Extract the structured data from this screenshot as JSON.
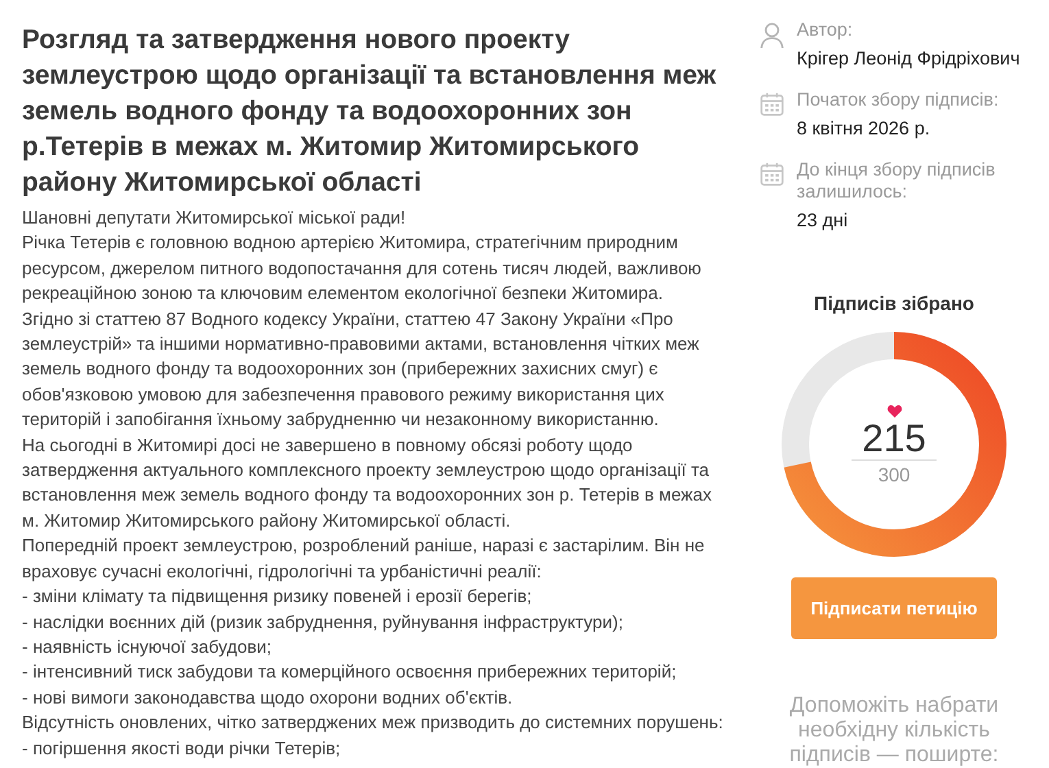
{
  "petition": {
    "title": "Розгляд та затвердження нового проекту землеустрою щодо організації та встановлення меж земель водного фонду та водоохоронних зон р.Тетерів в межах м. Житомир Житомирського району Житомирської області",
    "body": [
      "Шановні депутати Житомирської міської ради!",
      "Річка Тетерів є головною водною артерією Житомира, стратегічним природним ресурсом, джерелом питного водопостачання для сотень тисяч людей, важливою рекреаційною зоною та ключовим елементом екологічної безпеки Житомира.",
      "Згідно зі статтею 87 Водного кодексу України, статтею 47 Закону України «Про землеустрій» та іншими нормативно-правовими актами, встановлення чітких меж земель водного фонду та водоохоронних зон (прибережних захисних смуг) є обов'язковою умовою для забезпечення правового режиму використання цих територій і запобігання їхньому забрудненню чи незаконному використанню.",
      "На сьогодні в Житомирі досі не завершено в повному обсязі роботу щодо затвердження актуального комплексного проекту землеустрою щодо організації та встановлення меж земель водного фонду та водоохоронних зон р. Тетерів в межах м. Житомир Житомирського району Житомирської області.",
      "Попередній проект землеустрою, розроблений раніше, наразі є застарілим. Він не враховує сучасні екологічні, гідрологічні та урбаністичні реалії:",
      "- зміни клімату та підвищення ризику повеней і ерозії берегів;",
      "- наслідки воєнних дій (ризик забруднення, руйнування інфраструктури);",
      "- наявність існуючої забудови;",
      "- інтенсивний тиск забудови та комерційного освоєння прибережних територій;",
      "- нові вимоги законодавства щодо охорони водних об'єктів.",
      "Відсутність оновлених, чітко затверджених меж призводить до системних порушень:",
      "- погіршення якості води річки Тетерів;"
    ]
  },
  "details": [
    {
      "kind": "person",
      "label": "Автор:",
      "value": "Крігер Леонід Фрідріхович"
    },
    {
      "kind": "calendar",
      "label": "Початок збору підписів:",
      "value": "8 квітня 2026 р."
    },
    {
      "kind": "calendar",
      "label": "До кінця збору підписів залишилось:",
      "value": "23 дні"
    }
  ],
  "signatures": {
    "title": "Підписів зібрано",
    "count": "215",
    "goal": "300",
    "level": 0.7167
  },
  "sign_button": "Підписати петицію",
  "share_prompt": "Допоможіть набрати необхідну кількість підписів — поширте:"
}
